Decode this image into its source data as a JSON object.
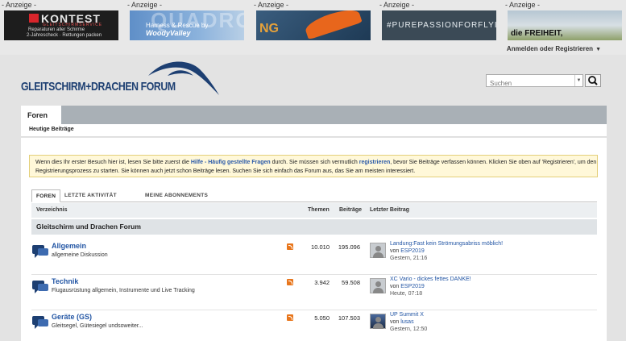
{
  "ads": [
    {
      "label": "- Anzeige -",
      "brand": "KONTEST",
      "brand_sub": "GLEITSCHIRMSERVICE",
      "line1": "Reparaturen aller Schirme",
      "line2": "2-Jahrescheck · Rettungen packen"
    },
    {
      "label": "- Anzeige -",
      "big": "QUADRO",
      "text": "Harness & Rescue by ",
      "text_brand": "WoodyValley"
    },
    {
      "label": "- Anzeige -",
      "logo": "NG"
    },
    {
      "label": "- Anzeige -",
      "text": "#PUREPASSIONFORFLYING"
    },
    {
      "label": "- Anzeige -",
      "text": "die FREIHEIT,"
    }
  ],
  "header": {
    "login_label": "Anmelden oder Registrieren",
    "forum_title": "GLEITSCHIRM+DRACHEN FORUM",
    "search_placeholder": "Suchen"
  },
  "nav": {
    "active_tab": "Foren",
    "subnav_item": "Heutige Beiträge"
  },
  "notice": {
    "part1": "Wenn dies Ihr erster Besuch hier ist, lesen Sie bitte zuerst die ",
    "link1": "Hilfe - Häufig gestellte Fragen",
    "part2": " durch. Sie müssen sich vermutlich ",
    "link2": "registrieren",
    "part3": ", bevor Sie Beiträge verfassen können. Klicken Sie oben auf 'Registrieren', um den Registrierungsprozess zu starten. Sie können auch jetzt schon Beiträge lesen. Suchen Sie sich einfach das Forum aus, das Sie am meisten interessiert."
  },
  "forum_tabs": [
    "FOREN",
    "LETZTE AKTIVITÄT",
    "MEINE ABONNEMENTS"
  ],
  "table_headers": {
    "directory": "Verzeichnis",
    "topics": "Themen",
    "posts": "Beiträge",
    "last_post": "Letzter Beitrag"
  },
  "category": "Gleitschirm und Drachen Forum",
  "forums": [
    {
      "name": "Allgemein",
      "desc": "allgemeine Diskussion",
      "topics": "10.010",
      "posts": "195.096",
      "last_title": "Landung:Fast kein Strömungsabriss möblich!",
      "by_prefix": "von ",
      "last_user": "ESP2019",
      "last_date": "Gestern, 21:16"
    },
    {
      "name": "Technik",
      "desc": "Flugausrüstung allgemein, Instrumente und Live Tracking",
      "topics": "3.942",
      "posts": "59.508",
      "last_title": "XC Vario - dickes fettes DANKE!",
      "by_prefix": "von ",
      "last_user": "ESP2019",
      "last_date": "Heute, 07:18"
    },
    {
      "name": "Geräte (GS)",
      "desc": "Gleitsegel, Gütesiegel undsoweiter...",
      "topics": "5.050",
      "posts": "107.503",
      "last_title": "UP Summit X",
      "by_prefix": "von ",
      "last_user": "lusas",
      "last_date": "Gestern, 12:50"
    }
  ],
  "colors": {
    "link": "#2255a4",
    "logo": "#1d3f72",
    "notice_bg": "#fff8d9",
    "nav_bar": "#a9b0b6",
    "rss": "#e8761c"
  }
}
